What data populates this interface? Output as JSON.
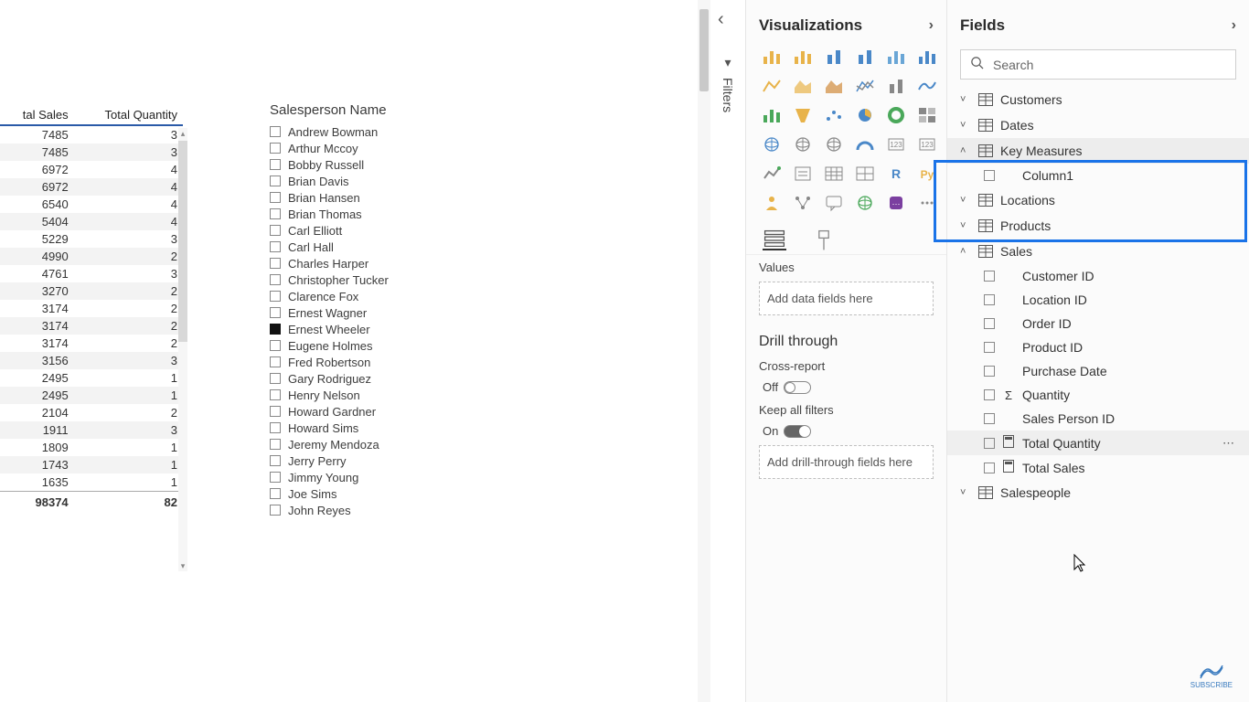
{
  "table": {
    "headers": [
      "tal Sales",
      "Total Quantity"
    ],
    "rows": [
      [
        7485,
        3
      ],
      [
        7485,
        3
      ],
      [
        6972,
        4
      ],
      [
        6972,
        4
      ],
      [
        6540,
        4
      ],
      [
        5404,
        4
      ],
      [
        5229,
        3
      ],
      [
        4990,
        2
      ],
      [
        4761,
        3
      ],
      [
        3270,
        2
      ],
      [
        3174,
        2
      ],
      [
        3174,
        2
      ],
      [
        3174,
        2
      ],
      [
        3156,
        3
      ],
      [
        2495,
        1
      ],
      [
        2495,
        1
      ],
      [
        2104,
        2
      ],
      [
        1911,
        3
      ],
      [
        1809,
        1
      ],
      [
        1743,
        1
      ],
      [
        1635,
        1
      ]
    ],
    "totals": [
      98374,
      82
    ]
  },
  "slicer": {
    "title": "Salesperson Name",
    "items": [
      {
        "label": "Andrew Bowman",
        "checked": false
      },
      {
        "label": "Arthur Mccoy",
        "checked": false
      },
      {
        "label": "Bobby Russell",
        "checked": false
      },
      {
        "label": "Brian Davis",
        "checked": false
      },
      {
        "label": "Brian Hansen",
        "checked": false
      },
      {
        "label": "Brian Thomas",
        "checked": false
      },
      {
        "label": "Carl Elliott",
        "checked": false
      },
      {
        "label": "Carl Hall",
        "checked": false
      },
      {
        "label": "Charles Harper",
        "checked": false
      },
      {
        "label": "Christopher Tucker",
        "checked": false
      },
      {
        "label": "Clarence Fox",
        "checked": false
      },
      {
        "label": "Ernest Wagner",
        "checked": false
      },
      {
        "label": "Ernest Wheeler",
        "checked": true
      },
      {
        "label": "Eugene Holmes",
        "checked": false
      },
      {
        "label": "Fred Robertson",
        "checked": false
      },
      {
        "label": "Gary Rodriguez",
        "checked": false
      },
      {
        "label": "Henry Nelson",
        "checked": false
      },
      {
        "label": "Howard Gardner",
        "checked": false
      },
      {
        "label": "Howard Sims",
        "checked": false
      },
      {
        "label": "Jeremy Mendoza",
        "checked": false
      },
      {
        "label": "Jerry Perry",
        "checked": false
      },
      {
        "label": "Jimmy Young",
        "checked": false
      },
      {
        "label": "Joe Sims",
        "checked": false
      },
      {
        "label": "John Reyes",
        "checked": false
      }
    ]
  },
  "filters_tab": "Filters",
  "viz": {
    "title": "Visualizations",
    "values_label": "Values",
    "values_placeholder": "Add data fields here",
    "drill_header": "Drill through",
    "cross_report_label": "Cross-report",
    "cross_report_state": "Off",
    "keep_filters_label": "Keep all filters",
    "keep_filters_state": "On",
    "drill_placeholder": "Add drill-through fields here"
  },
  "fields": {
    "title": "Fields",
    "search_placeholder": "Search",
    "groups": [
      {
        "name": "Customers",
        "expanded": false
      },
      {
        "name": "Dates",
        "expanded": false
      },
      {
        "name": "Key Measures",
        "expanded": true,
        "highlighted": true,
        "items": [
          {
            "label": "Column1",
            "checkbox": true
          }
        ]
      },
      {
        "name": "Locations",
        "expanded": false
      },
      {
        "name": "Products",
        "expanded": false
      },
      {
        "name": "Sales",
        "expanded": true,
        "items": [
          {
            "label": "Customer ID",
            "checkbox": true
          },
          {
            "label": "Location ID",
            "checkbox": true
          },
          {
            "label": "Order ID",
            "checkbox": true
          },
          {
            "label": "Product ID",
            "checkbox": true
          },
          {
            "label": "Purchase Date",
            "checkbox": true
          },
          {
            "label": "Quantity",
            "checkbox": true,
            "sigma": true
          },
          {
            "label": "Sales Person ID",
            "checkbox": true
          },
          {
            "label": "Total Quantity",
            "checkbox": true,
            "calc": true,
            "hover": true
          },
          {
            "label": "Total Sales",
            "checkbox": true,
            "calc": true
          }
        ]
      },
      {
        "name": "Salespeople",
        "expanded": false
      }
    ]
  },
  "subscribe_label": "SUBSCRIBE"
}
